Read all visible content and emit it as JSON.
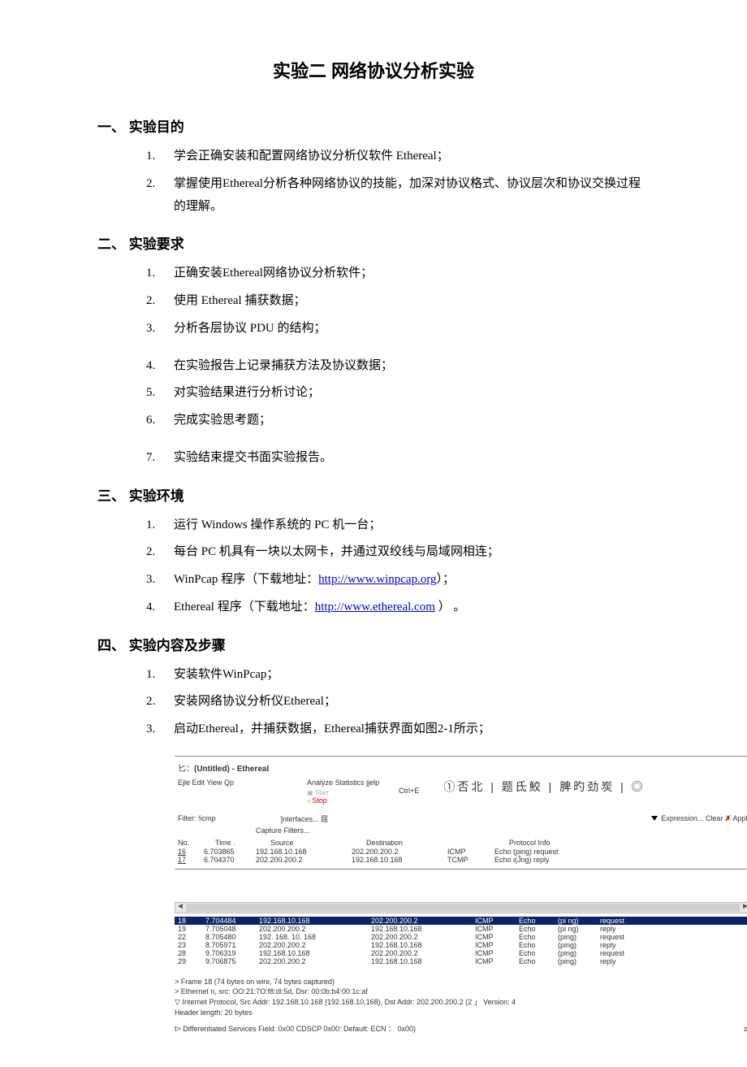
{
  "title": "实验二  网络协议分析实验",
  "sections": {
    "s1": {
      "heading": "一、  实验目的",
      "items": [
        "学会正确安装和配置网络协议分析仪软件 Ethereal；",
        "掌握使用Ethereal分析各种网络协议的技能，加深对协议格式、协议层次和协议交换过程的理解。"
      ]
    },
    "s2": {
      "heading": "二、  实验要求",
      "items": [
        "正确安装Ethereal网络协议分析软件；",
        "使用 Ethereal 捕获数据；",
        "分析各层协议 PDU 的结构；",
        "在实验报告上记录捕获方法及协议数据；",
        "对实验结果进行分析讨论；",
        "完成实验思考题；",
        "实验结束提交书面实验报告。"
      ]
    },
    "s3": {
      "heading": "三、  实验环境",
      "items": [
        "运行 Windows 操作系统的 PC 机一台；",
        "每台 PC 机具有一块以太网卡，并通过双绞线与局域网相连；",
        {
          "pre": "WinPcap 程序（下载地址：",
          "link": "http://www.winpcap.org",
          "post": "）；"
        },
        {
          "pre": "Ethereal 程序（下载地址：",
          "link": "http://www.ethereal.com",
          "post": " ） 。"
        }
      ]
    },
    "s4": {
      "heading": "四、  实验内容及步骤",
      "items": [
        "安装软件WinPcap；",
        "安装网络协议分析仪Ethereal；",
        "启动Ethereal，并捕获数据，Ethereal捕获界面如图2-1所示；"
      ]
    }
  },
  "figure": {
    "win_title_prefix": "匕：",
    "win_title": "(Untitled) - Ethereal",
    "menus": "Ejle Edit Yiew Qp",
    "menu_right": "Analyze Statistics jjelp",
    "start_label": "Start",
    "stop_label": "Stop",
    "ctrl_e": "Ctrl+E",
    "interfaces": "]nterfaces...",
    "capture_filters": "Capture Filters...",
    "icons_right": "①否北 | 题氐鮫 | 脾旳劲炭 | ◎",
    "filter_label": "Filter:",
    "filter_value": "!icmp",
    "expr": "Expression... Clear",
    "apply": "Apply",
    "headers": [
      "No.",
      "Time .",
      "Source",
      "Destination",
      "",
      "Protocol Info"
    ],
    "rows_top": [
      [
        "16",
        "6.703865",
        "192.168.10.168",
        "202.200.200.2",
        "ICMP",
        "Echo (ping) request"
      ],
      [
        "17",
        "6.704370",
        "202.200.200.2",
        "192.168.10.168",
        "TCMP",
        "Echo i(Ĵng) reply"
      ]
    ],
    "rows_sel": [
      "18",
      "7.704484",
      "192.168.10.168",
      "202.200.200.2",
      "ICMP",
      "Echo",
      "(pi ng)",
      "request"
    ],
    "rows_bottom": [
      [
        "19",
        "7.705048",
        "202.200.200.2",
        "192.168.10.168",
        "ICMP",
        "Echo",
        "(pi ng)",
        "reply"
      ],
      [
        "22",
        "8.705480",
        "192. 168. 10. 168",
        "202.200.200.2",
        "ICMP",
        "Echo",
        "(ping)",
        "request"
      ],
      [
        "23",
        "8.705971",
        "202.200.200.2",
        "192.168.10.168",
        "ICMP",
        "Echo",
        "(ping)",
        "reply"
      ],
      [
        "28",
        "9.706319",
        "192.168.10.168",
        "202.200.200.2",
        "ICMP",
        "Echo",
        "(ping)",
        "request"
      ],
      [
        "29",
        "9.706875",
        "202.200.200.2",
        "192.168.10.168",
        "ICMP",
        "Echo",
        "(ping)",
        "reply"
      ]
    ],
    "detail_lines": [
      ">   Frame 18 (74 bytes on wire, 74 bytes captured)",
      ">   Ethernet n, src: OO:21:7O:f8:dl:5d, Dsr: 00:0b:b4:00:1c:af",
      "▽ Internet Protocol, Src Addr: 192.168.10.168 (192.168.10,168), Dst Addr: 202.200.200.2 (2 」  Version: 4",
      "       Header length: 20 bytes",
      "t> Differentiated Services Field: 0x00 CDSCP 0x00: Default: ECN ：  0x00)"
    ],
    "zj": "zJ"
  }
}
